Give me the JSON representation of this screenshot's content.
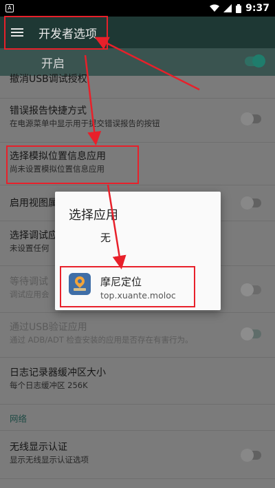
{
  "status_bar": {
    "time": "9:37",
    "app_indicator": "A"
  },
  "toolbar": {
    "title": "开发者选项",
    "menu_icon": "hamburger-menu-icon"
  },
  "master": {
    "label": "开启",
    "enabled": true
  },
  "settings": [
    {
      "title": "撤消USB调试授权",
      "subtitle": ""
    },
    {
      "title": "错误报告快捷方式",
      "subtitle": "在电源菜单中显示用于提交错误报告的按钮",
      "toggle": false
    },
    {
      "title": "选择模拟位置信息应用",
      "subtitle": "尚未设置模拟位置信息应用"
    },
    {
      "title": "启用视图属",
      "subtitle": "",
      "toggle": false
    },
    {
      "title": "选择调试应",
      "subtitle": "未设置任何"
    },
    {
      "title": "等待调试",
      "subtitle": "调试应用会",
      "toggle": false,
      "disabled": true
    },
    {
      "title": "通过USB验证应用",
      "subtitle": "通过 ADB/ADT 检查安装的应用是否存在有害行为。",
      "toggle": true,
      "disabled": true
    },
    {
      "title": "日志记录器缓冲区大小",
      "subtitle": "每个日志缓冲区 256K"
    },
    {
      "title": "无线显示认证",
      "subtitle": "显示无线显示认证选项",
      "toggle": false
    }
  ],
  "section": {
    "network": "网络"
  },
  "dialog": {
    "title": "选择应用",
    "none_option": "无",
    "app": {
      "name": "摩尼定位",
      "package": "top.xuante.moloc",
      "icon": "location-pin-icon"
    }
  },
  "colors": {
    "toolbar": "#1e3834",
    "accent": "#1f7d6c",
    "annotation": "#e8202a"
  }
}
